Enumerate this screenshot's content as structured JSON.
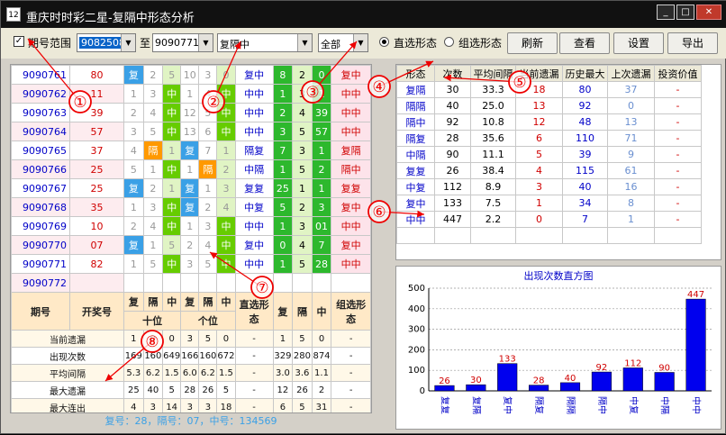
{
  "window": {
    "title": "重庆时时彩二星-复隔中形态分析",
    "app_icon": "12"
  },
  "toolbar": {
    "period_range_label": "期号范围",
    "period_from": "9082508",
    "to_label": "至",
    "period_to": "9090771",
    "pattern_select": "复隔中",
    "filter_select": "全部",
    "radio_direct": "直选形态",
    "radio_group": "组选形态",
    "btn_refresh": "刷新",
    "btn_view": "查看",
    "btn_settings": "设置",
    "btn_export": "导出"
  },
  "left_rows": [
    {
      "period": "9090761",
      "num": "80",
      "cells": [
        "复",
        "2",
        "5",
        "10",
        "3",
        "0"
      ],
      "direct": "复中",
      "a": "8",
      "b": "2",
      "c": "0",
      "group": "复中"
    },
    {
      "period": "9090762",
      "num": "11",
      "cells": [
        "1",
        "3",
        "中",
        "1",
        "4",
        "中"
      ],
      "direct": "中中",
      "a": "1",
      "b": "3",
      "c": "1",
      "group": "中中"
    },
    {
      "period": "9090763",
      "num": "39",
      "cards": "",
      "cells": [
        "2",
        "4",
        "中",
        "12",
        "5",
        "中"
      ],
      "direct": "中中",
      "a": "2",
      "b": "4",
      "c": "39",
      "group": "中中"
    },
    {
      "period": "9090764",
      "num": "57",
      "cells": [
        "3",
        "5",
        "中",
        "13",
        "6",
        "中"
      ],
      "direct": "中中",
      "a": "3",
      "b": "5",
      "c": "57",
      "group": "中中"
    },
    {
      "period": "9090765",
      "num": "37",
      "cells": [
        "4",
        "隔",
        "1",
        "复",
        "7",
        "1"
      ],
      "direct": "隔复",
      "a": "7",
      "b": "3",
      "c": "1",
      "group": "复隔"
    },
    {
      "period": "9090766",
      "num": "25",
      "cells": [
        "5",
        "1",
        "中",
        "1",
        "隔",
        "2"
      ],
      "direct": "中隔",
      "a": "1",
      "b": "5",
      "c": "2",
      "group": "隔中"
    },
    {
      "period": "9090767",
      "num": "25",
      "cells": [
        "复",
        "2",
        "1",
        "复",
        "1",
        "3"
      ],
      "direct": "复复",
      "a": "25",
      "b": "1",
      "c": "1",
      "group": "复复"
    },
    {
      "period": "9090768",
      "num": "35",
      "cells": [
        "1",
        "3",
        "中",
        "复",
        "2",
        "4"
      ],
      "direct": "中复",
      "a": "5",
      "b": "2",
      "c": "3",
      "group": "复中"
    },
    {
      "period": "9090769",
      "num": "10",
      "cells": [
        "2",
        "4",
        "中",
        "1",
        "3",
        "中"
      ],
      "direct": "中中",
      "a": "1",
      "b": "3",
      "c": "01",
      "group": "中中"
    },
    {
      "period": "9090770",
      "num": "07",
      "cells": [
        "复",
        "1",
        "5",
        "2",
        "4",
        "中"
      ],
      "direct": "复中",
      "a": "0",
      "b": "4",
      "c": "7",
      "group": "复中"
    },
    {
      "period": "9090771",
      "num": "82",
      "cells": [
        "1",
        "5",
        "中",
        "3",
        "5",
        "中"
      ],
      "direct": "中中",
      "a": "1",
      "b": "5",
      "c": "28",
      "group": "中中"
    },
    {
      "period": "9090772",
      "num": "",
      "cells": [
        "",
        "",
        "",
        "",
        "",
        ""
      ],
      "direct": "",
      "a": "",
      "b": "",
      "c": "",
      "group": ""
    }
  ],
  "stats_header": {
    "period": "期号",
    "num": "开奖号",
    "f": "复",
    "g": "隔",
    "z": "中",
    "tens": "十位",
    "ones": "个位",
    "direct": "直选形态",
    "group": "组选形态"
  },
  "stats_rows": [
    {
      "label": "当前遗漏",
      "v": [
        "1",
        "0",
        "0",
        "3",
        "5",
        "0"
      ],
      "direct": "-",
      "a": "1",
      "b": "5",
      "c": "0",
      "group": "-"
    },
    {
      "label": "出现次数",
      "v": [
        "169",
        "160",
        "649",
        "166",
        "160",
        "672"
      ],
      "direct": "-",
      "a": "329",
      "b": "280",
      "c": "874",
      "group": "-"
    },
    {
      "label": "平均间隔",
      "v": [
        "5.3",
        "6.2",
        "1.5",
        "6.0",
        "6.2",
        "1.5"
      ],
      "direct": "-",
      "a": "3.0",
      "b": "3.6",
      "c": "1.1",
      "group": "-"
    },
    {
      "label": "最大遗漏",
      "v": [
        "25",
        "40",
        "5",
        "28",
        "26",
        "5"
      ],
      "direct": "-",
      "a": "12",
      "b": "26",
      "c": "2",
      "group": "-"
    },
    {
      "label": "最大连出",
      "v": [
        "4",
        "3",
        "14",
        "3",
        "3",
        "18"
      ],
      "direct": "-",
      "a": "6",
      "b": "5",
      "c": "31",
      "group": "-"
    }
  ],
  "footer": "复号：28，隔号：07，中号：134569",
  "right_table": {
    "headers": [
      "形态",
      "次数",
      "平均间隔",
      "当前遗漏",
      "历史最大",
      "上次遗漏",
      "投资价值"
    ],
    "rows": [
      [
        "复隔",
        "30",
        "33.3",
        "18",
        "80",
        "37",
        "-"
      ],
      [
        "隔隔",
        "40",
        "25.0",
        "13",
        "92",
        "0",
        "-"
      ],
      [
        "隔中",
        "92",
        "10.8",
        "12",
        "48",
        "13",
        "-"
      ],
      [
        "隔复",
        "28",
        "35.6",
        "6",
        "110",
        "71",
        "-"
      ],
      [
        "中隔",
        "90",
        "11.1",
        "5",
        "39",
        "9",
        "-"
      ],
      [
        "复复",
        "26",
        "38.4",
        "4",
        "115",
        "61",
        "-"
      ],
      [
        "中复",
        "112",
        "8.9",
        "3",
        "40",
        "16",
        "-"
      ],
      [
        "复中",
        "133",
        "7.5",
        "1",
        "34",
        "8",
        "-"
      ],
      [
        "中中",
        "447",
        "2.2",
        "0",
        "7",
        "1",
        "-"
      ]
    ]
  },
  "chart_data": {
    "type": "bar",
    "title": "出现次数直方图",
    "categories": [
      "复复",
      "复隔",
      "复中",
      "隔复",
      "隔隔",
      "隔中",
      "中复",
      "中隔",
      "中中"
    ],
    "values": [
      26,
      30,
      133,
      28,
      40,
      92,
      112,
      90,
      447
    ],
    "yticks": [
      "0",
      "100",
      "200",
      "300",
      "400",
      "500"
    ],
    "ylim": [
      0,
      500
    ],
    "bar_color": "#0000ee",
    "label_color": "#d00000",
    "grid": true
  },
  "annotations": [
    "①",
    "②",
    "③",
    "④",
    "⑤",
    "⑥",
    "⑦",
    "⑧"
  ]
}
